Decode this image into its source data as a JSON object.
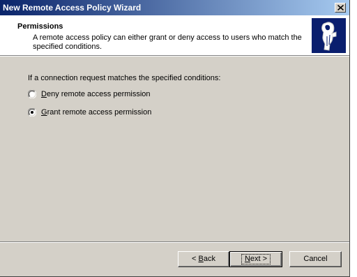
{
  "window": {
    "title": "New Remote Access Policy Wizard"
  },
  "header": {
    "title": "Permissions",
    "description": "A remote access policy can either grant or deny access to users who match the specified conditions.",
    "icon": "wizard-permissions-icon"
  },
  "body": {
    "prompt": "If a connection request matches the specified conditions:",
    "options": [
      {
        "mnemonic": "D",
        "rest": "eny remote access permission",
        "selected": false
      },
      {
        "mnemonic": "G",
        "rest": "rant remote access permission",
        "selected": true
      }
    ]
  },
  "buttons": {
    "back": {
      "prefix": "< ",
      "mnemonic": "B",
      "rest": "ack"
    },
    "next": {
      "mnemonic": "N",
      "rest": "ext >"
    },
    "cancel": "Cancel"
  },
  "colors": {
    "titlebar_start": "#0a246a",
    "titlebar_end": "#a6caf0",
    "dialog_bg": "#d4d0c8",
    "header_icon_bg": "#0a1e6e"
  }
}
